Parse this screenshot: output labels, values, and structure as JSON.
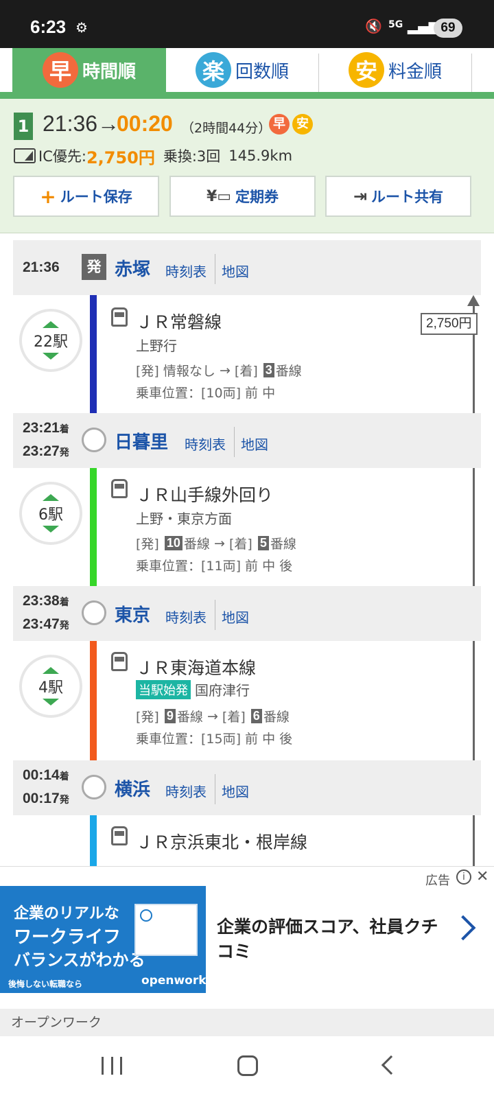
{
  "status_bar": {
    "time": "6:23",
    "battery": "69",
    "network": "5G"
  },
  "tabs": [
    {
      "badge": "早",
      "label": "時間順",
      "active": true,
      "color": "#f26a3d"
    },
    {
      "badge": "楽",
      "label": "回数順",
      "active": false,
      "color": "#3aa9d8"
    },
    {
      "badge": "安",
      "label": "料金順",
      "active": false,
      "color": "#f7b500"
    }
  ],
  "summary": {
    "route_number": "1",
    "depart": "21:36→",
    "arrive": "00:20",
    "duration": "（2時間44分）",
    "badges": [
      "早",
      "安"
    ],
    "fare_label": "IC優先:",
    "fare": "2,750円",
    "transfers": "乗換:3回",
    "distance": "145.9km",
    "buttons": {
      "save": "ルート保存",
      "pass": "定期券",
      "share": "ルート共有"
    }
  },
  "stations": [
    {
      "name": "赤塚",
      "time_dep": "21:36",
      "dep_mark": "発",
      "timetable": "時刻表",
      "map": "地図"
    },
    {
      "name": "日暮里",
      "time_arr": "23:21",
      "time_dep": "23:27",
      "timetable": "時刻表",
      "map": "地図"
    },
    {
      "name": "東京",
      "time_arr": "23:38",
      "time_dep": "23:47",
      "timetable": "時刻表",
      "map": "地図"
    },
    {
      "name": "横浜",
      "time_arr": "00:14",
      "time_dep": "00:17",
      "timetable": "時刻表",
      "map": "地図"
    }
  ],
  "time_suffix": {
    "arr": "着",
    "dep": "発"
  },
  "segments": [
    {
      "line": "ＪＲ常磐線",
      "dest": "上野行",
      "count": "22駅",
      "color": "#1f2fb5",
      "plat_dep_label": "[発]",
      "plat_dep": "情報なし",
      "arrow": "→",
      "plat_arr_label": "[着]",
      "plat_arr": "3",
      "plat_suffix": "番線",
      "position": "乗車位置：[10両] 前 中"
    },
    {
      "line": "ＪＲ山手線外回り",
      "dest": "上野・東京方面",
      "count": "6駅",
      "color": "#36d629",
      "plat_dep_label": "[発]",
      "plat_dep": "10",
      "plat_dep_suffix": "番線",
      "arrow": "→",
      "plat_arr_label": "[着]",
      "plat_arr": "5",
      "plat_suffix": "番線",
      "position": "乗車位置：[11両] 前 中 後"
    },
    {
      "line": "ＪＲ東海道本線",
      "origin_tag": "当駅始発",
      "dest": "国府津行",
      "count": "4駅",
      "color": "#f25a1d",
      "plat_dep_label": "[発]",
      "plat_dep": "9",
      "plat_dep_suffix": "番線",
      "arrow": "→",
      "plat_arr_label": "[着]",
      "plat_arr": "6",
      "plat_suffix": "番線",
      "position": "乗車位置：[15両] 前 中 後"
    },
    {
      "line": "ＪＲ京浜東北・根岸線",
      "color": "#1aa7e8"
    }
  ],
  "fare_box": "2,750円",
  "ad": {
    "label": "広告",
    "banner_line1": "企業のリアルな",
    "banner_line2": "ワークライフ",
    "banner_line3": "バランスがわかる",
    "banner_foot_left": "後悔しない転職なら",
    "banner_foot_right": "openwork",
    "headline": "企業の評価スコア、社員クチコミ",
    "sponsor": "オープンワーク"
  }
}
